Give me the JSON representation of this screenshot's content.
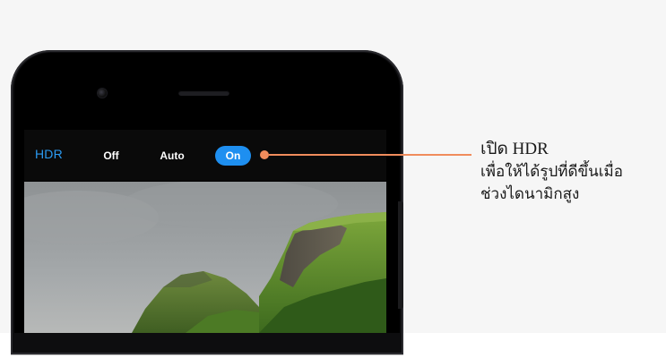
{
  "camera_settings": {
    "hdr_label": "HDR",
    "options": [
      "Off",
      "Auto",
      "On"
    ],
    "selected_option": "On"
  },
  "callout": {
    "title": "เปิด HDR",
    "line2": "เพื่อให้ได้รูปที่ดีขึ้นเมื่อ",
    "line3": "ช่วงไดนามิกสูง"
  },
  "colors": {
    "hdr_label": "#2b9bf2",
    "selected_pill": "#1e8ff0",
    "callout_accent": "#f08c5c",
    "background": "#f6f6f6"
  },
  "icons": [
    "front-camera-icon",
    "earpiece-speaker-icon"
  ]
}
